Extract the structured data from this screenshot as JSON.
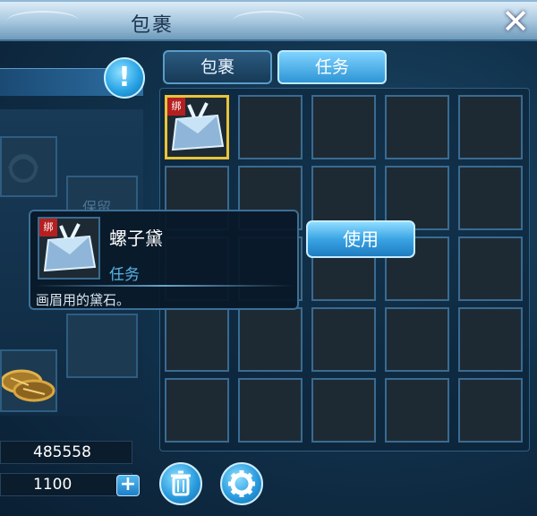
{
  "window": {
    "title": "包裹",
    "close_glyph": "✕"
  },
  "info_button": {
    "glyph": "!"
  },
  "tabs": [
    {
      "label": "包裹",
      "active": false
    },
    {
      "label": "任务",
      "active": true
    }
  ],
  "left_panel": {
    "reserve_label": "保留",
    "stats": [
      {
        "value": "485558"
      },
      {
        "value": "1100"
      }
    ],
    "add_glyph": "+"
  },
  "grid": {
    "rows": 5,
    "cols": 5,
    "selected_index": 0
  },
  "item": {
    "bind_tag": "绑",
    "name": "螺子黛",
    "type": "任务",
    "description": "画眉用的黛石。",
    "icon": "cloth-bundle-icon"
  },
  "actions": {
    "use_label": "使用",
    "delete_icon": "trash-icon",
    "settings_icon": "gear-icon"
  },
  "colors": {
    "accent": "#3aa4e4",
    "selected_border": "#e8c43a",
    "bind_tag": "#b51f1f",
    "item_type": "#58b6e8"
  }
}
